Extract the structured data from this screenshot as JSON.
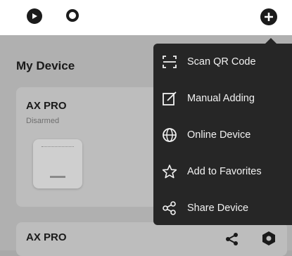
{
  "header": {
    "icons": [
      "play-icon",
      "o-icon",
      "plus-icon"
    ]
  },
  "main": {
    "title": "My Device",
    "devices": [
      {
        "name": "AX PRO",
        "status": "Disarmed"
      },
      {
        "name": "AX PRO",
        "status": ""
      }
    ]
  },
  "menu": {
    "items": [
      {
        "label": "Scan QR Code",
        "icon": "scan-qr-icon"
      },
      {
        "label": "Manual Adding",
        "icon": "edit-icon"
      },
      {
        "label": "Online Device",
        "icon": "globe-icon"
      },
      {
        "label": "Add to Favorites",
        "icon": "star-icon"
      },
      {
        "label": "Share Device",
        "icon": "share-icon"
      }
    ]
  },
  "colors": {
    "menu_bg": "#262626",
    "menu_text": "#f2f2f2",
    "overlay_bg": "#b0b0b0",
    "topbar_bg": "#ffffff"
  }
}
